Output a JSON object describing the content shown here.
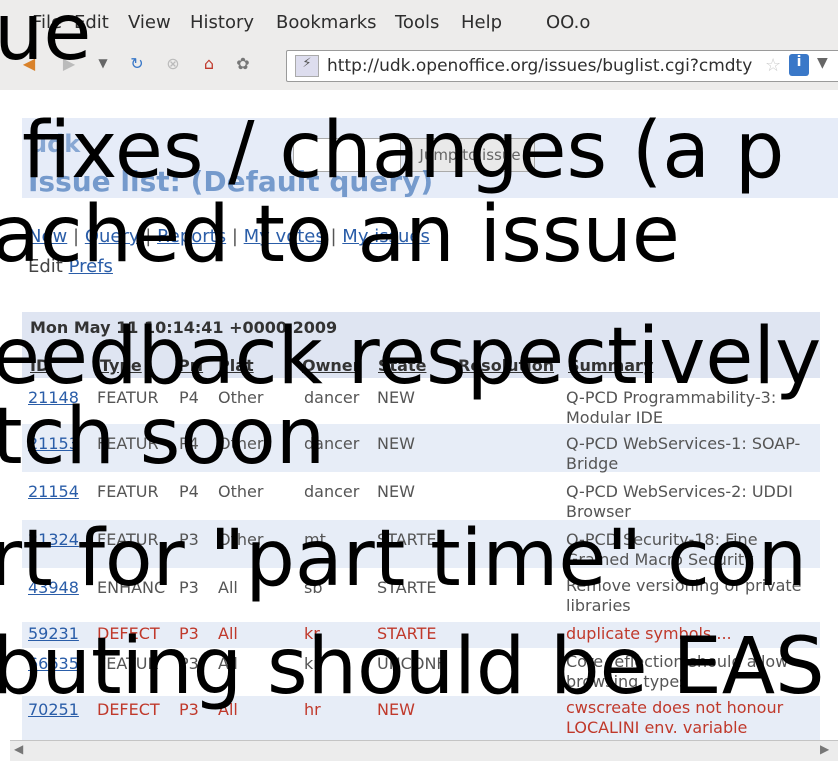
{
  "menu": [
    "File",
    "Edit",
    "View",
    "History",
    "Bookmarks",
    "Tools",
    "Help",
    "OO.o"
  ],
  "url": "http://udk.openoffice.org/issues/buglist.cgi?cmdty",
  "header": {
    "udk_label": "udk",
    "title": "Issue list: (Default query)",
    "jump_button": "Jump to issue"
  },
  "links": [
    "New",
    "Query",
    "Reports",
    "My votes",
    "My issues"
  ],
  "edit_prefs": {
    "prefix": "Edit",
    "link": "Prefs"
  },
  "datetime": "Mon May 11 10:14:41 +0000 2009",
  "columns": [
    "ID",
    "Type",
    "Pri",
    "Plat",
    "Owner",
    "State",
    "Resolution",
    "Summary"
  ],
  "rows": [
    {
      "id": "21148",
      "type": "FEATUR",
      "pri": "P4",
      "plat": "Other",
      "owner": "dancer",
      "state": "NEW",
      "summary": "Q-PCD Programmability-3: Modular IDE"
    },
    {
      "id": "21153",
      "type": "FEATUR",
      "pri": "P4",
      "plat": "Other",
      "owner": "dancer",
      "state": "NEW",
      "summary": "Q-PCD WebServices-1: SOAP-Bridge"
    },
    {
      "id": "21154",
      "type": "FEATUR",
      "pri": "P4",
      "plat": "Other",
      "owner": "dancer",
      "state": "NEW",
      "summary": "Q-PCD WebServices-2: UDDI Browser"
    },
    {
      "id": "21324",
      "type": "FEATUR",
      "pri": "P3",
      "plat": "Other",
      "owner": "mt",
      "state": "STARTE",
      "summary": "Q-PCD Security-18: Fine Grained Macro Security"
    },
    {
      "id": "43948",
      "type": "ENHANC",
      "pri": "P3",
      "plat": "All",
      "owner": "sb",
      "state": "STARTE",
      "summary": "Remove versioning of private libraries"
    },
    {
      "id": "59231",
      "type": "DEFECT",
      "pri": "P3",
      "plat": "All",
      "owner": "kr",
      "state": "STARTE",
      "summary": "duplicate symbols ..."
    },
    {
      "id": "66635",
      "type": "FEATUR",
      "pri": "P3",
      "plat": "All",
      "owner": "kr",
      "state": "UNCONF",
      "summary": "Core reflection should allow browsing types"
    },
    {
      "id": "70251",
      "type": "DEFECT",
      "pri": "P3",
      "plat": "All",
      "owner": "hr",
      "state": "NEW",
      "summary": "cwscreate does not honour LOCALINI env. variable"
    }
  ],
  "overlay": [
    "ue",
    "fixes / changes (a p",
    "ached to an issue",
    "eedback respectively",
    "tch soon",
    "rt for \"part time\" con",
    "buting should be EAS"
  ]
}
